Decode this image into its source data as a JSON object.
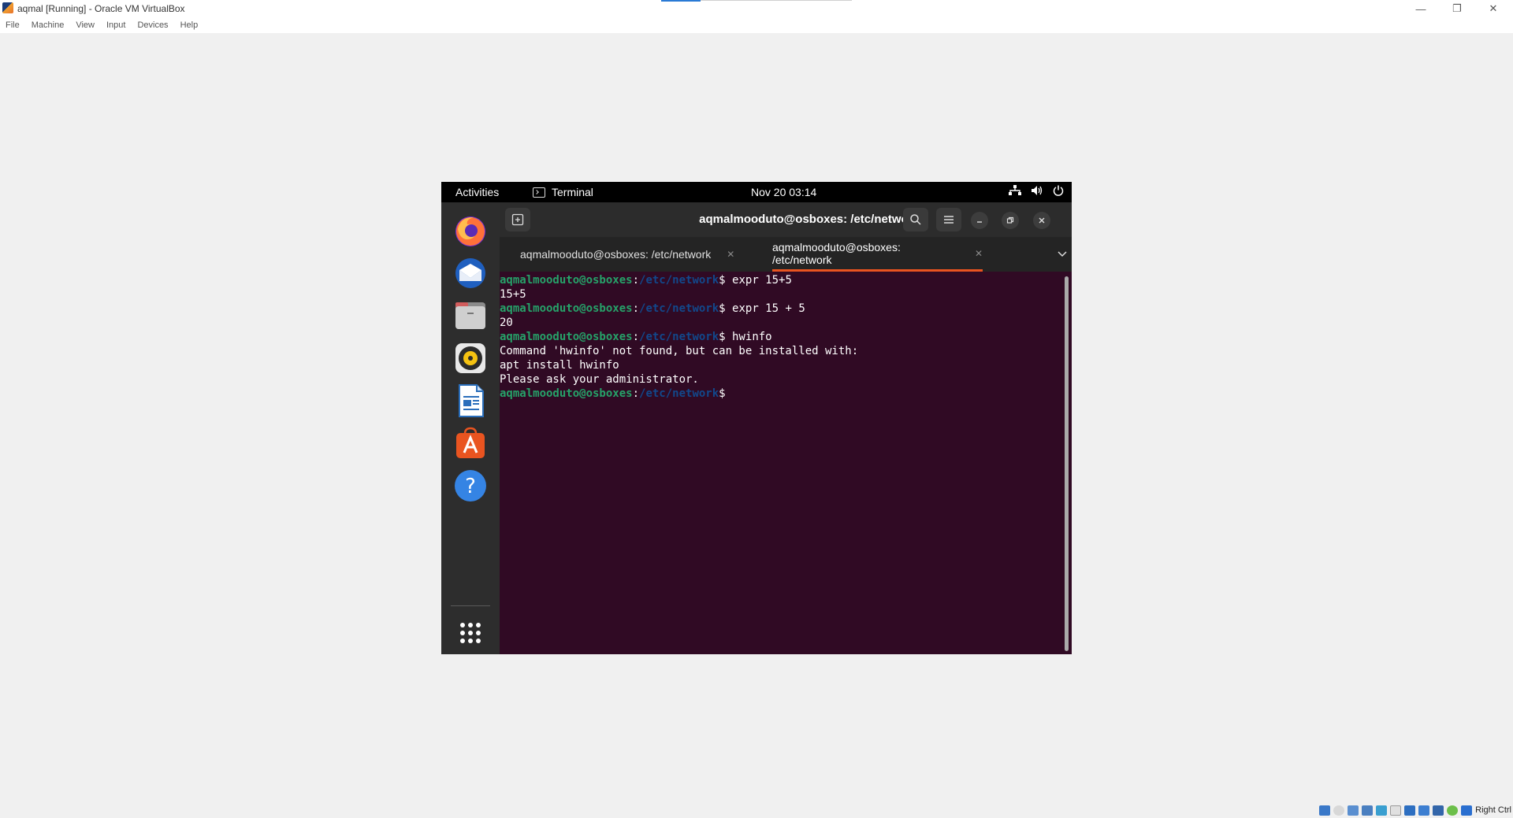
{
  "host": {
    "title": "aqmal [Running] - Oracle VM VirtualBox",
    "menu": [
      "File",
      "Machine",
      "View",
      "Input",
      "Devices",
      "Help"
    ],
    "window_controls": {
      "minimize": "—",
      "restore": "❐",
      "close": "✕"
    },
    "host_key": "Right Ctrl"
  },
  "guest": {
    "topbar": {
      "activities": "Activities",
      "app_name": "Terminal",
      "clock": "Nov 20  03:14"
    },
    "dock": {
      "apps": [
        "Firefox",
        "Thunderbird",
        "Files",
        "Rhythmbox",
        "LibreOffice Writer",
        "Ubuntu Software",
        "Help",
        "Show Applications"
      ]
    },
    "terminal": {
      "title": "aqmalmooduto@osboxes: /etc/network",
      "tabs": [
        {
          "label": "aqmalmooduto@osboxes: /etc/network",
          "active": false
        },
        {
          "label": "aqmalmooduto@osboxes: /etc/network",
          "active": true
        }
      ],
      "prompt_user": "aqmalmooduto@osboxes",
      "prompt_path": "/etc/network",
      "lines": [
        {
          "type": "cmd",
          "cmd": " expr 15+5"
        },
        {
          "type": "out",
          "text": "15+5"
        },
        {
          "type": "cmd",
          "cmd": " expr 15 + 5"
        },
        {
          "type": "out",
          "text": "20"
        },
        {
          "type": "cmd",
          "cmd": " hwinfo"
        },
        {
          "type": "out",
          "text": "Command 'hwinfo' not found, but can be installed with:"
        },
        {
          "type": "out",
          "text": "apt install hwinfo"
        },
        {
          "type": "out",
          "text": "Please ask your administrator."
        },
        {
          "type": "cmd",
          "cmd": ""
        }
      ]
    }
  },
  "colors": {
    "terminal_bg": "#300a24",
    "prompt_user": "#26a269",
    "prompt_path": "#12488b",
    "tab_accent": "#e95420"
  }
}
